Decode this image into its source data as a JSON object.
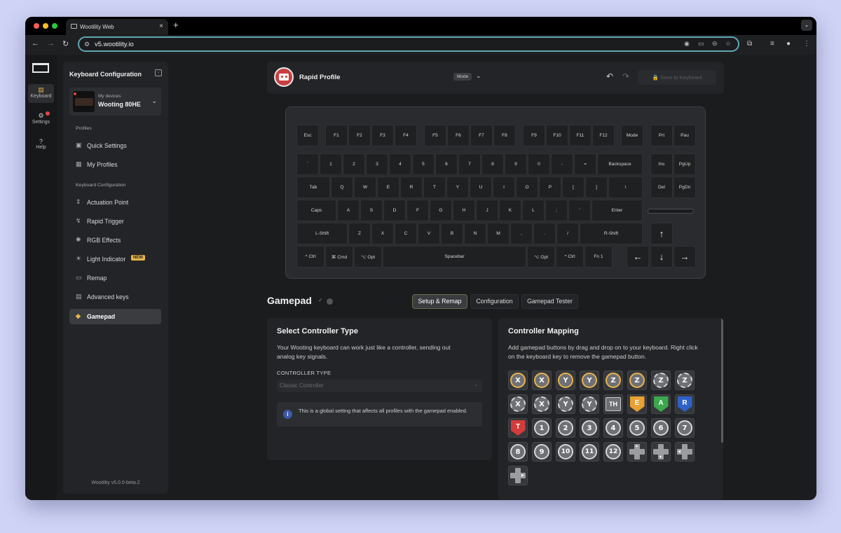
{
  "browser": {
    "tab_title": "Wootility Web",
    "url": "v5.wootility.io"
  },
  "rail": [
    {
      "label": "Keyboard",
      "icon": "keyboard-icon"
    },
    {
      "label": "Settings",
      "icon": "gear-icon"
    },
    {
      "label": "Help",
      "icon": "help-icon"
    }
  ],
  "sidebar": {
    "title": "Keyboard Configuration",
    "device_caption": "My devices",
    "device_name": "Wooting 80HE",
    "profiles_section": "Profiles",
    "config_section": "Keyboard Configuration",
    "items": [
      {
        "label": "Quick Settings",
        "icon": "quick-settings-icon"
      },
      {
        "label": "My Profiles",
        "icon": "profiles-icon"
      },
      {
        "label": "Actuation Point",
        "icon": "actuation-icon"
      },
      {
        "label": "Rapid Trigger",
        "icon": "rapid-trigger-icon"
      },
      {
        "label": "RGB Effects",
        "icon": "rgb-icon"
      },
      {
        "label": "Light Indicator",
        "icon": "light-icon",
        "badge": "NEW"
      },
      {
        "label": "Remap",
        "icon": "remap-icon"
      },
      {
        "label": "Advanced keys",
        "icon": "advanced-keys-icon"
      },
      {
        "label": "Gamepad",
        "icon": "gamepad-icon",
        "active": true
      }
    ],
    "version": "Wootility v5.0.0-beta.2"
  },
  "profile": {
    "name": "Rapid Profile",
    "mode": "Mode",
    "save_label": "Save to Keyboard"
  },
  "keyboard": {
    "rows": [
      [
        "Esc",
        "F1",
        "F2",
        "F3",
        "F4",
        "F5",
        "F6",
        "F7",
        "F8",
        "F9",
        "F10",
        "F11",
        "F12",
        "Mode",
        "Prt",
        "Pau"
      ],
      [
        "`",
        "1",
        "2",
        "3",
        "4",
        "5",
        "6",
        "7",
        "8",
        "9",
        "0",
        "-",
        "=",
        "Backspace",
        "Ins",
        "PgUp"
      ],
      [
        "Tab",
        "Q",
        "W",
        "E",
        "R",
        "T",
        "Y",
        "U",
        "I",
        "O",
        "P",
        "[",
        "]",
        "\\",
        "Del",
        "PgDn"
      ],
      [
        "Caps",
        "A",
        "S",
        "D",
        "F",
        "G",
        "H",
        "J",
        "K",
        "L",
        ";",
        "'",
        "Enter"
      ],
      [
        "L-Shift",
        "Z",
        "X",
        "C",
        "V",
        "B",
        "N",
        "M",
        ",",
        ".",
        "/",
        "R-Shift",
        "↑"
      ],
      [
        "^ Ctrl",
        "⌘ Cmd",
        "⌥ Opt",
        "Spacebar",
        "⌥ Opt",
        "^ Ctrl",
        "Fn 1",
        "←",
        "↓",
        "→"
      ]
    ]
  },
  "gamepad": {
    "title": "Gamepad",
    "tabs": [
      "Setup & Remap",
      "Configuration",
      "Gamepad Tester"
    ],
    "active_tab": "Setup & Remap",
    "controller_type": {
      "title": "Select Controller Type",
      "description_line1": "Your Wooting keyboard can work just like a controller, sending out",
      "description_line2": "analog key signals.",
      "label": "CONTROLLER TYPE",
      "value": "Classic Controller",
      "info": "This is a global setting that affects all profiles with the gamepad enabled."
    },
    "mapping": {
      "title": "Controller Mapping",
      "description_line1": "Add gamepad buttons by drag and drop on to your keyboard. Right click",
      "description_line2": "on the keyboard key to remove the gamepad button.",
      "buttons": [
        [
          "X",
          "circle-trigger"
        ],
        [
          "X",
          "circle-trigger"
        ],
        [
          "Y",
          "circle-trigger"
        ],
        [
          "Y",
          "circle-trigger"
        ],
        [
          "Z",
          "circle-trigger"
        ],
        [
          "Z",
          "circle-trigger"
        ],
        [
          "Z",
          "circle-rot"
        ],
        [
          "Z",
          "circle-rot"
        ],
        [
          "X",
          "circle-rot"
        ],
        [
          "X",
          "circle-rot"
        ],
        [
          "Y",
          "circle-rot"
        ],
        [
          "Y",
          "circle-rot"
        ],
        [
          "TH",
          "square"
        ],
        [
          "E",
          "shield-orange"
        ],
        [
          "A",
          "shield-green"
        ],
        [
          "R",
          "shield-blue"
        ],
        [
          "T",
          "shield-red"
        ],
        [
          "1",
          "circle"
        ],
        [
          "2",
          "circle"
        ],
        [
          "3",
          "circle"
        ],
        [
          "4",
          "circle"
        ],
        [
          "5",
          "circle"
        ],
        [
          "6",
          "circle"
        ],
        [
          "7",
          "circle"
        ],
        [
          "8",
          "circle"
        ],
        [
          "9",
          "circle"
        ],
        [
          "10",
          "circle"
        ],
        [
          "11",
          "circle"
        ],
        [
          "12",
          "circle"
        ],
        [
          "",
          "dpad-up"
        ],
        [
          "",
          "dpad-down"
        ],
        [
          "",
          "dpad-left"
        ],
        [
          "",
          "dpad-right"
        ]
      ]
    }
  },
  "colors": {
    "accent": "#e8b34a",
    "danger": "#e04646",
    "shield_orange": "#e8a132",
    "shield_green": "#3aa84b",
    "shield_blue": "#2f62c8",
    "shield_red": "#d63b3b"
  }
}
